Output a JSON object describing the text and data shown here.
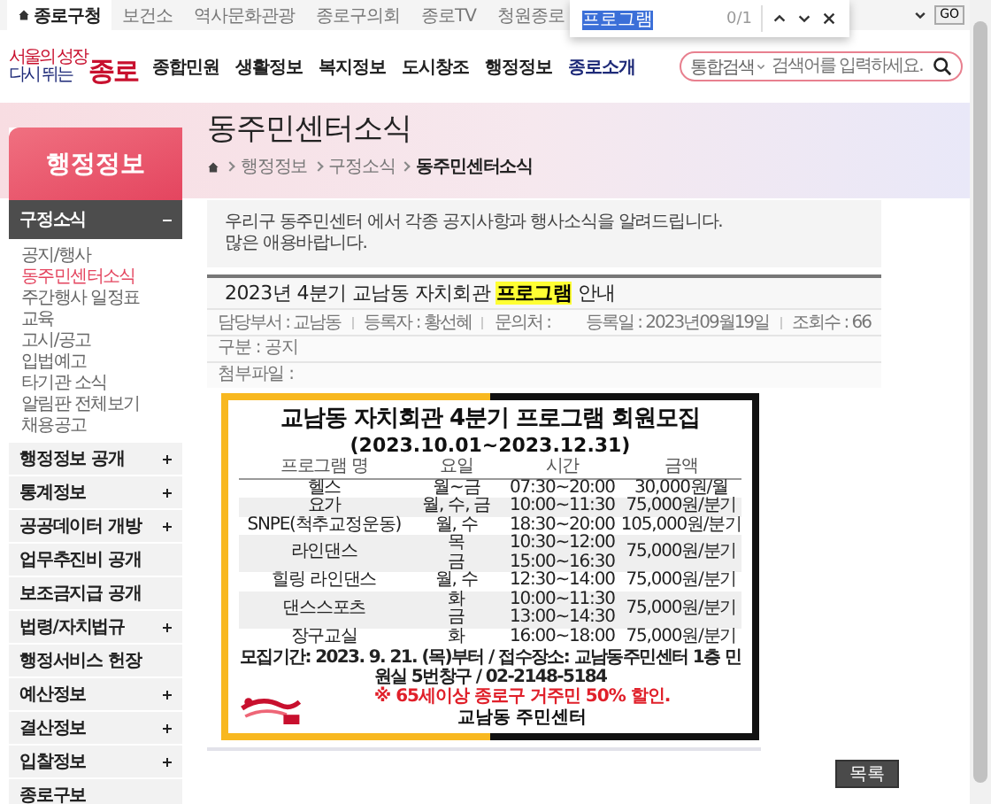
{
  "top_bar": {
    "sites": [
      {
        "label": "종로구청",
        "selected": true
      },
      {
        "label": "보건소",
        "selected": false
      },
      {
        "label": "역사문화관광",
        "selected": false
      },
      {
        "label": "종로구의회",
        "selected": false
      },
      {
        "label": "종로TV",
        "selected": false
      },
      {
        "label": "청원종로",
        "selected": false
      }
    ],
    "go_button": "GO"
  },
  "find_bar": {
    "query": "프로그램",
    "count": "0/1"
  },
  "header": {
    "logo": {
      "line_1": "서울의 성장",
      "line_2": "다시 뛰는",
      "name": "종로"
    },
    "nav": [
      {
        "label": "종합민원",
        "selected": false
      },
      {
        "label": "생활정보",
        "selected": false
      },
      {
        "label": "복지정보",
        "selected": false
      },
      {
        "label": "도시창조",
        "selected": false
      },
      {
        "label": "행정정보",
        "selected": false
      },
      {
        "label": "종로소개",
        "selected": true
      }
    ],
    "search": {
      "scope": "통합검색",
      "placeholder": "검색어를 입력하세요."
    }
  },
  "sidebar": {
    "title": "행정정보",
    "sections": [
      {
        "label": "구정소식",
        "expandable": true,
        "expanded": true,
        "children": [
          {
            "label": "공지/행사",
            "selected": false
          },
          {
            "label": "동주민센터소식",
            "selected": true
          },
          {
            "label": "주간행사 일정표",
            "selected": false
          },
          {
            "label": "교육",
            "selected": false
          },
          {
            "label": "고시/공고",
            "selected": false
          },
          {
            "label": "입법예고",
            "selected": false
          },
          {
            "label": "타기관 소식",
            "selected": false
          },
          {
            "label": "알림판 전체보기",
            "selected": false
          },
          {
            "label": "채용공고",
            "selected": false
          }
        ]
      },
      {
        "label": "행정정보 공개",
        "expandable": true,
        "expanded": false
      },
      {
        "label": "통계정보",
        "expandable": true,
        "expanded": false
      },
      {
        "label": "공공데이터 개방",
        "expandable": true,
        "expanded": false
      },
      {
        "label": "업무추진비 공개",
        "expandable": false,
        "expanded": false
      },
      {
        "label": "보조금지급 공개",
        "expandable": false,
        "expanded": false
      },
      {
        "label": "법령/자치법규",
        "expandable": true,
        "expanded": false
      },
      {
        "label": "행정서비스 헌장",
        "expandable": false,
        "expanded": false
      },
      {
        "label": "예산정보",
        "expandable": true,
        "expanded": false
      },
      {
        "label": "결산정보",
        "expandable": true,
        "expanded": false
      },
      {
        "label": "입찰정보",
        "expandable": true,
        "expanded": false
      },
      {
        "label": "종로구보",
        "expandable": false,
        "expanded": false
      }
    ]
  },
  "page": {
    "title": "동주민센터소식",
    "breadcrumb": [
      "행정정보",
      "구정소식",
      "동주민센터소식"
    ],
    "intro": [
      "우리구 동주민센터 에서 각종 공지사항과 행사소식을 알려드립니다.",
      "많은 애용바랍니다."
    ],
    "post": {
      "title_before": "2023년 4분기 교남동 자치회관 ",
      "title_match": "프로그램",
      "title_after": " 안내",
      "meta_left": [
        "담당부서 : 교남동",
        "등록자 : 황선혜",
        "문의처 :"
      ],
      "meta_right": [
        "등록일 : 2023년09월19일",
        "조회수 : 66"
      ],
      "fields": [
        "구분 : 공지",
        "첨부파일 :"
      ],
      "poster": {
        "title": "교남동 자치회관 4분기 프로그램 회원모집",
        "period": "(2023.10.01~2023.12.31)",
        "columns": [
          "프로그램 명",
          "요일",
          "시간",
          "금액"
        ],
        "rows": [
          {
            "name": "헬스",
            "days": [
              "월~금"
            ],
            "times": [
              "07:30~20:00"
            ],
            "fee": "30,000원/월"
          },
          {
            "name": "요가",
            "days": [
              "월, 수, 금"
            ],
            "times": [
              "10:00~11:30"
            ],
            "fee": "75,000원/분기"
          },
          {
            "name": "SNPE(척추교정운동)",
            "days": [
              "월, 수"
            ],
            "times": [
              "18:30~20:00"
            ],
            "fee": "105,000원/분기"
          },
          {
            "name": "라인댄스",
            "days": [
              "목",
              "금"
            ],
            "times": [
              "10:30~12:00",
              "15:00~16:30"
            ],
            "fee": "75,000원/분기"
          },
          {
            "name": "힐링 라인댄스",
            "days": [
              "월, 수"
            ],
            "times": [
              "12:30~14:00"
            ],
            "fee": "75,000원/분기"
          },
          {
            "name": "댄스스포츠",
            "days": [
              "화",
              "금"
            ],
            "times": [
              "10:00~11:30",
              "13:00~14:30"
            ],
            "fee": "75,000원/분기"
          },
          {
            "name": "장구교실",
            "days": [
              "화"
            ],
            "times": [
              "16:00~18:00"
            ],
            "fee": "75,000원/분기"
          }
        ],
        "notice": "모집기간: 2023. 9. 21. (목)부터 / 접수장소: 교남동주민센터 1층 민원실 5번창구 / 02-2148-5184",
        "discount": "※ 65세이상 종로구 거주민 50% 할인.",
        "organizer": "교남동 주민센터"
      }
    },
    "list_button": "목록"
  }
}
